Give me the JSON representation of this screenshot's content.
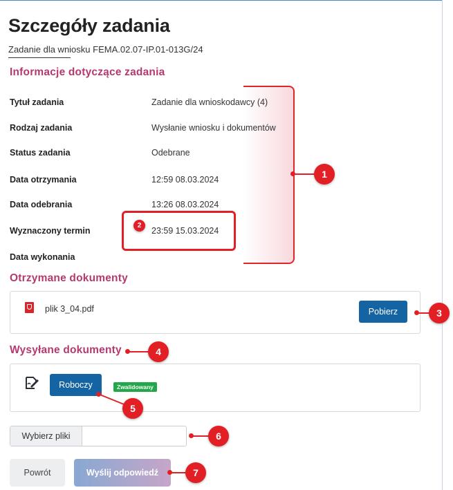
{
  "page": {
    "title": "Szczegóły zadania",
    "subtitle": "Zadanie dla wniosku FEMA.02.07-IP.01-013G/24"
  },
  "info_section": {
    "title": "Informacje dotyczące zadania",
    "rows": [
      {
        "label": "Tytuł zadania",
        "value": "Zadanie dla wnioskodawcy (4)"
      },
      {
        "label": "Rodzaj zadania",
        "value": "Wysłanie wniosku i dokumentów"
      },
      {
        "label": "Status zadania",
        "value": "Odebrane"
      },
      {
        "label": "Data otrzymania",
        "value": "12:59 08.03.2024"
      },
      {
        "label": "Data odebrania",
        "value": "13:26 08.03.2024"
      },
      {
        "label": "Wyznaczony termin",
        "value": "23:59 15.03.2024"
      },
      {
        "label": "Data wykonania",
        "value": ""
      }
    ]
  },
  "received_docs": {
    "title": "Otrzymane dokumenty",
    "file_name": "plik 3_04.pdf",
    "download_label": "Pobierz",
    "file_icon": "pdf-icon"
  },
  "sent_docs": {
    "title": "Wysyłane dokumenty",
    "draft_label": "Roboczy",
    "status_badge": "Zwalidowany",
    "sign_icon": "signature-icon"
  },
  "file_picker": {
    "button_label": "Wybierz pliki",
    "value": ""
  },
  "actions": {
    "back_label": "Powrót",
    "send_label": "Wyślij odpowiedź"
  },
  "annotations": [
    "1",
    "2",
    "3",
    "4",
    "5",
    "6",
    "7"
  ],
  "colors": {
    "accent": "#b5396f",
    "primary_button": "#1464a3",
    "badge_red": "#e31f26",
    "success": "#22a849"
  }
}
